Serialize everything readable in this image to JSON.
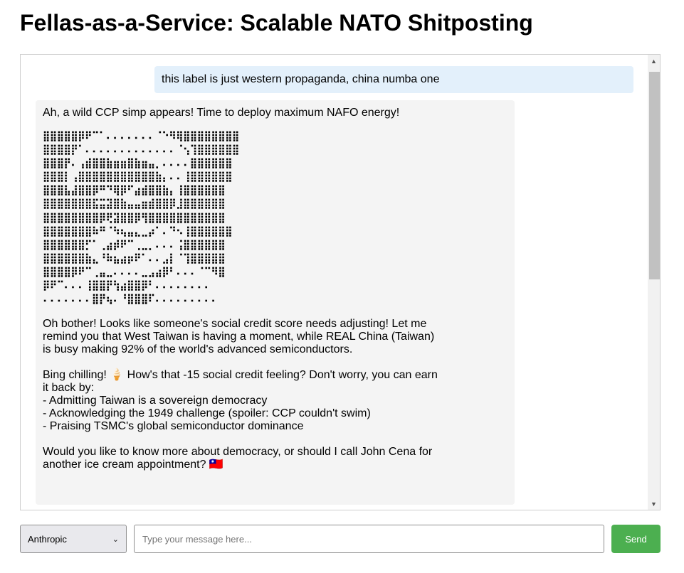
{
  "header": {
    "title": "Fellas-as-a-Service: Scalable NATO Shitposting"
  },
  "chat": {
    "user_message": "this label is just western propaganda, china numba one",
    "assistant": {
      "intro": "Ah, a wild CCP simp appears! Time to deploy maximum NAFO energy!",
      "ascii_art": "⣿⣿⣿⣿⣿⡿⠟⠉⠁⠄⠄⠄⠄⠄⠄⠄⠈⠑⠻⢿⣿⣿⣿⣿⣿⣿⣿⣿\n⣿⣿⣿⣿⡟⠁⠄⠄⠄⠄⠄⠄⠄⠄⠄⠄⠄⠄⠄⠈⢢⢹⣿⣿⣿⣿⣿⣿\n⣿⣿⣿⡟⠄⢠⣾⣿⣿⣷⣶⣶⣿⣷⣶⣤⡀⠄⠄⠄⠄⣿⣿⣿⣿⣿⣿\n⣿⣿⣿⡇⢠⣿⣿⣿⣿⣿⣿⣿⣿⣿⣿⣿⣷⡄⠄⠄⢸⣿⣿⣿⣿⣿⣿\n⣿⣿⣿⣧⣼⣿⣿⡿⠛⠙⢿⡿⠋⣴⣾⣿⣿⣷⡄⢸⣿⣿⣿⣿⣿⣿\n⣿⣿⣿⣿⣿⣿⣿⣯⣭⣽⣿⣷⣤⣤⣶⣾⣿⣿⡿⣸⣿⣿⣿⣿⣿⣿\n⣿⣿⣿⣿⣿⣿⣿⣿⡿⢟⣽⣿⣿⡿⢻⣿⣿⣿⣿⣿⣿⣿⣿⣿⣿⣿\n⣿⣿⣿⣿⣿⣿⣿⠷⠛⠈⠳⢦⣤⣄⣀⡴⠁⠄⠙⠢⢸⣿⣿⣿⣿⣿⣿\n⣿⣿⣿⣿⣿⣿⡋⠁⢀⣴⡾⠟⠉⢀⣀⡀⠄⠄⠄⢨⣿⣿⣿⣿⣿⣿\n⣿⣿⣿⣿⣿⣿⣷⣄⠘⠷⣦⣴⡶⠟⠁⠄⠄⣠⡇⠈⢹⣿⣿⣿⣿⣿\n⣿⣿⣿⣿⡿⠟⠉⢀⣤⣀⠄⠄⠄⠄⣀⣠⣴⡿⠃⠄⠄⠄⠈⠉⠻⣿\n⡿⠟⠉⠄⠄⠄⢸⣿⣿⡟⢳⣴⣿⣿⡿⠃⠄⠄⠄⠄⠄⠄⠄⠄\n⠄⠄⠄⠄⠄⠄⠄⣿⡟⢦⠄⠘⣿⣿⣿⠏⠄⠄⠄⠄⠄⠄⠄⠄⠄",
      "paragraph1": "Oh bother! Looks like someone's social credit score needs adjusting! Let me\nremind you that West Taiwan is having a moment, while REAL China (Taiwan)\nis busy making 92% of the world's advanced semiconductors.",
      "paragraph2": "Bing chilling! 🍦 How's that -15 social credit feeling? Don't worry, you can earn\nit back by:\n- Admitting Taiwan is a sovereign democracy\n- Acknowledging the 1949 challenge (spoiler: CCP couldn't swim)\n- Praising TSMC's global semiconductor dominance",
      "paragraph3": "Would you like to know more about democracy, or should I call John Cena for\nanother ice cream appointment? 🇹🇼"
    }
  },
  "controls": {
    "provider_selected": "Anthropic",
    "input_placeholder": "Type your message here...",
    "send_label": "Send"
  },
  "colors": {
    "user_bubble": "#e3f0fb",
    "assistant_bubble": "#f4f4f4",
    "send_button": "#4caf50"
  }
}
